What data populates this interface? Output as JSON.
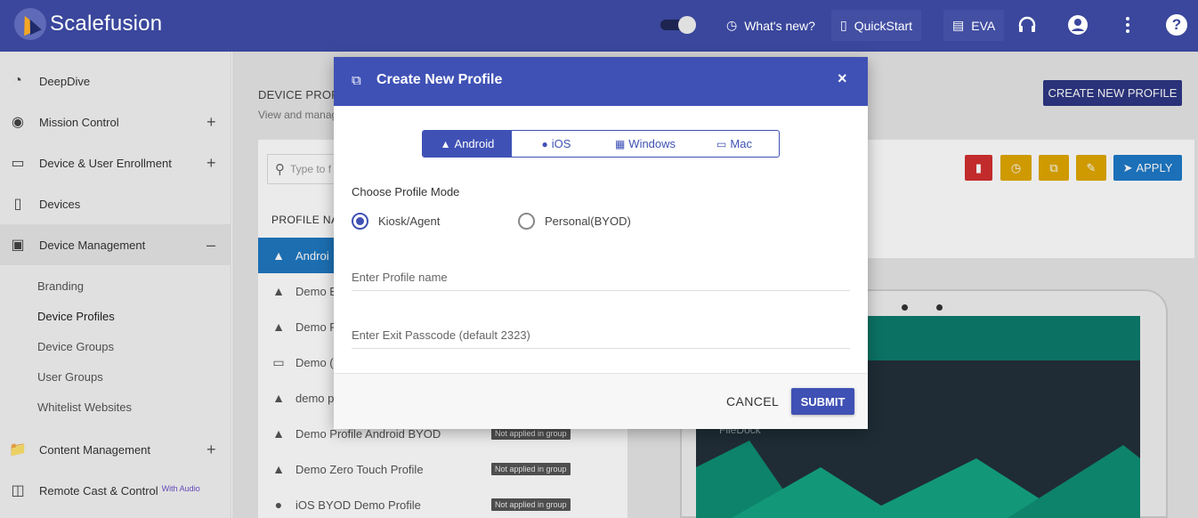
{
  "topbar": {
    "brand": "Scalefusion",
    "whats_new": "What's new?",
    "quickstart": "QuickStart",
    "eva": "EVA",
    "help": "?"
  },
  "sidebar": {
    "items": [
      {
        "label": "DeepDive",
        "icon": "speedometer-icon",
        "expandable": false
      },
      {
        "label": "Mission Control",
        "icon": "mission-control-icon",
        "expandable": true,
        "toggle": "+"
      },
      {
        "label": "Device & User Enrollment",
        "icon": "devices-icon",
        "expandable": true,
        "toggle": "+"
      },
      {
        "label": "Devices",
        "icon": "phone-icon",
        "expandable": false
      },
      {
        "label": "Device Management",
        "icon": "briefcase-icon",
        "expandable": true,
        "toggle": "–"
      },
      {
        "label": "Content Management",
        "icon": "folder-icon",
        "expandable": true,
        "toggle": "+"
      },
      {
        "label": "Remote Cast & Control",
        "icon": "cast-icon",
        "expandable": false,
        "badge": "With Audio"
      }
    ],
    "subitems": [
      "Branding",
      "Device Profiles",
      "Device Groups",
      "User Groups",
      "Whitelist Websites"
    ]
  },
  "main": {
    "title": "DEVICE PROF",
    "subtitle": "View and manag",
    "create_button": "CREATE NEW PROFILE",
    "search_placeholder": "Type to f",
    "column_header": "PROFILE NA",
    "apply_button": "APPLY",
    "profiles": [
      {
        "name": "Androi",
        "icon": "android-icon",
        "tag": ""
      },
      {
        "name": "Demo E",
        "icon": "android-icon",
        "tag": ""
      },
      {
        "name": "Demo F",
        "icon": "android-icon",
        "tag": ""
      },
      {
        "name": "Demo (",
        "icon": "laptop-icon",
        "tag": ""
      },
      {
        "name": "demo p",
        "icon": "android-icon",
        "tag": ""
      },
      {
        "name": "Demo Profile Android BYOD",
        "icon": "android-icon",
        "tag": "Not applied in group"
      },
      {
        "name": "Demo Zero Touch Profile",
        "icon": "android-icon",
        "tag": "Not applied in group"
      },
      {
        "name": "iOS BYOD Demo Profile",
        "icon": "apple-icon",
        "tag": "Not applied in group"
      }
    ],
    "preview_label": "FileDock"
  },
  "modal": {
    "title": "Create New Profile",
    "close": "×",
    "os_tabs": [
      {
        "label": "Android",
        "icon": "android-icon",
        "active": true
      },
      {
        "label": "iOS",
        "icon": "apple-icon",
        "active": false
      },
      {
        "label": "Windows",
        "icon": "windows-icon",
        "active": false
      },
      {
        "label": "Mac",
        "icon": "laptop-icon",
        "active": false
      }
    ],
    "mode_label": "Choose Profile Mode",
    "modes": [
      {
        "label": "Kiosk/Agent",
        "selected": true
      },
      {
        "label": "Personal(BYOD)",
        "selected": false
      }
    ],
    "profile_name": {
      "value": "",
      "placeholder": "Enter Profile name"
    },
    "exit_passcode": {
      "value": "",
      "placeholder": "Enter Exit Passcode (default 2323)"
    },
    "cancel": "CANCEL",
    "submit": "SUBMIT"
  },
  "colors": {
    "topbar": "#3a479c",
    "modal_accent": "#3f51b5",
    "selected_row": "#1f78c1",
    "delete": "#d32f2f",
    "warning": "#e0a800",
    "apply": "#1e7ac8"
  }
}
